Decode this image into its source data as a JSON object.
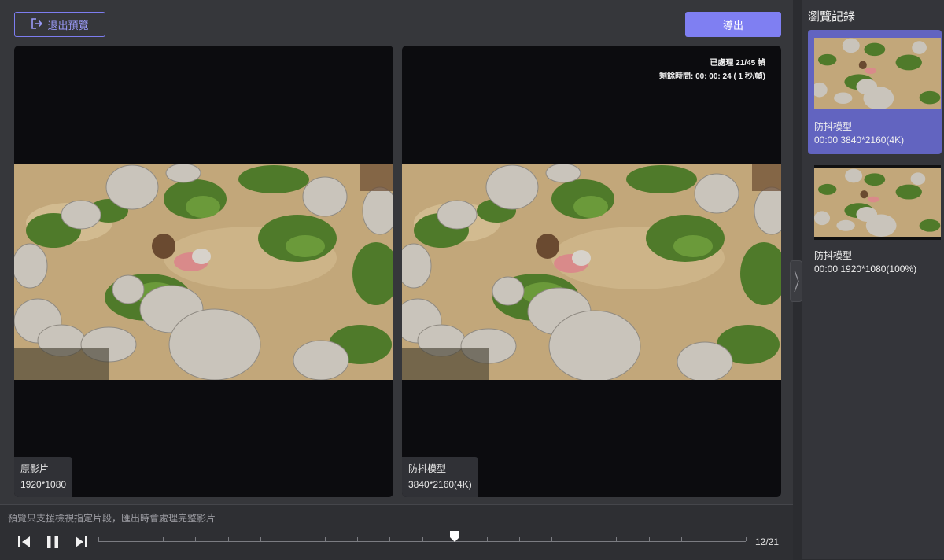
{
  "toolbar": {
    "exit_label": "退出預覽",
    "export_label": "導出"
  },
  "preview": {
    "original": {
      "title": "原影片",
      "resolution": "1920*1080"
    },
    "processed": {
      "title": "防抖模型",
      "resolution": "3840*2160(4K)",
      "processed_frames": "已處理 21/45 幀",
      "remaining_time": "剩餘時間: 00: 00: 24 ( 1 秒/幀)"
    }
  },
  "controls": {
    "hint": "預覽只支援檢視指定片段，匯出時會處理完整影片",
    "frame_counter": "12/21",
    "position": 0.55,
    "icons": [
      "step-back-icon",
      "pause-icon",
      "step-forward-icon"
    ]
  },
  "sidebar": {
    "title": "瀏覽記錄",
    "items": [
      {
        "name": "防抖模型",
        "meta": "00:00   3840*2160(4K)",
        "active": true
      },
      {
        "name": "防抖模型",
        "meta": "00:00   1920*1080(100%)",
        "active": false
      }
    ]
  },
  "colors": {
    "accent": "#7f7ff2",
    "active_item": "#6264c0",
    "background": "#2b2c30"
  }
}
